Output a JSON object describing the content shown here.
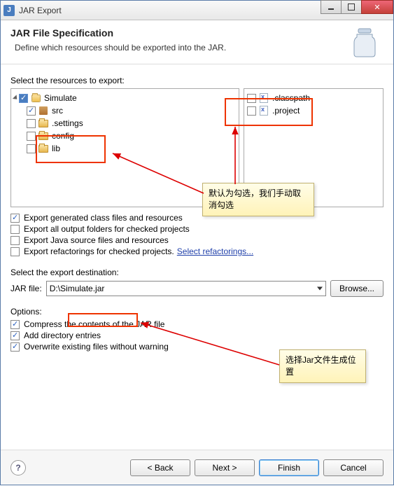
{
  "window": {
    "title": "JAR Export"
  },
  "header": {
    "title": "JAR File Specification",
    "subtitle": "Define which resources should be exported into the JAR."
  },
  "resources_label": "Select the resources to export:",
  "tree": {
    "project": "Simulate",
    "pkg_src": "src",
    "folder_settings": ".settings",
    "folder_config": "config",
    "folder_lib": "lib",
    "file_classpath": ".classpath",
    "file_project": ".project"
  },
  "export_opts": {
    "gen": "Export generated class files and resources",
    "out": "Export all output folders for checked projects",
    "src": "Export Java source files and resources",
    "refact": "Export refactorings for checked projects.",
    "refact_link": "Select refactorings..."
  },
  "dest": {
    "label": "Select the export destination:",
    "field_label": "JAR file:",
    "value": "D:\\Simulate.jar",
    "browse": "Browse..."
  },
  "options": {
    "label": "Options:",
    "compress": "Compress the contents of the JAR file",
    "adddir": "Add directory entries",
    "overwrite": "Overwrite existing files without warning"
  },
  "tooltips": {
    "t1": "默认为勾选，我们手动取消勾选",
    "t2": "选择Jar文件生成位置"
  },
  "footer": {
    "back": "< Back",
    "next": "Next >",
    "finish": "Finish",
    "cancel": "Cancel"
  }
}
